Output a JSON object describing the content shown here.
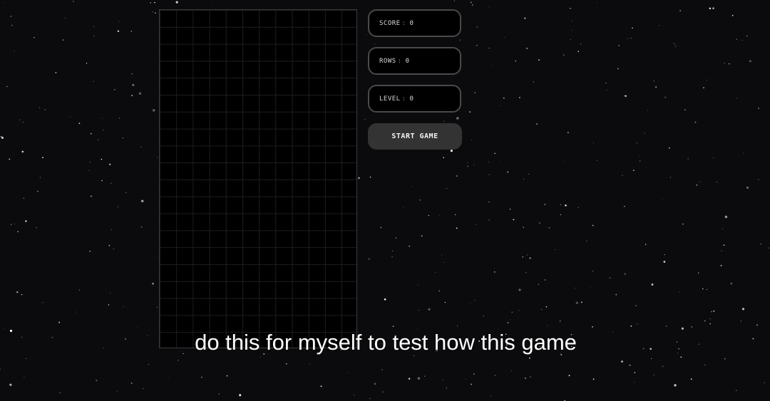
{
  "stats": {
    "score": {
      "label": "SCORE",
      "value": "0"
    },
    "rows": {
      "label": "ROWS",
      "value": "0"
    },
    "level": {
      "label": "LEVEL",
      "value": "0"
    }
  },
  "start_button_label": "START GAME",
  "caption": "do this for myself to test how this game",
  "colors": {
    "background": "#0b0b0d",
    "board": "#000000",
    "grid_line": "#1e1e1e",
    "panel_border": "#4a4a4a",
    "button_bg": "#333333"
  }
}
